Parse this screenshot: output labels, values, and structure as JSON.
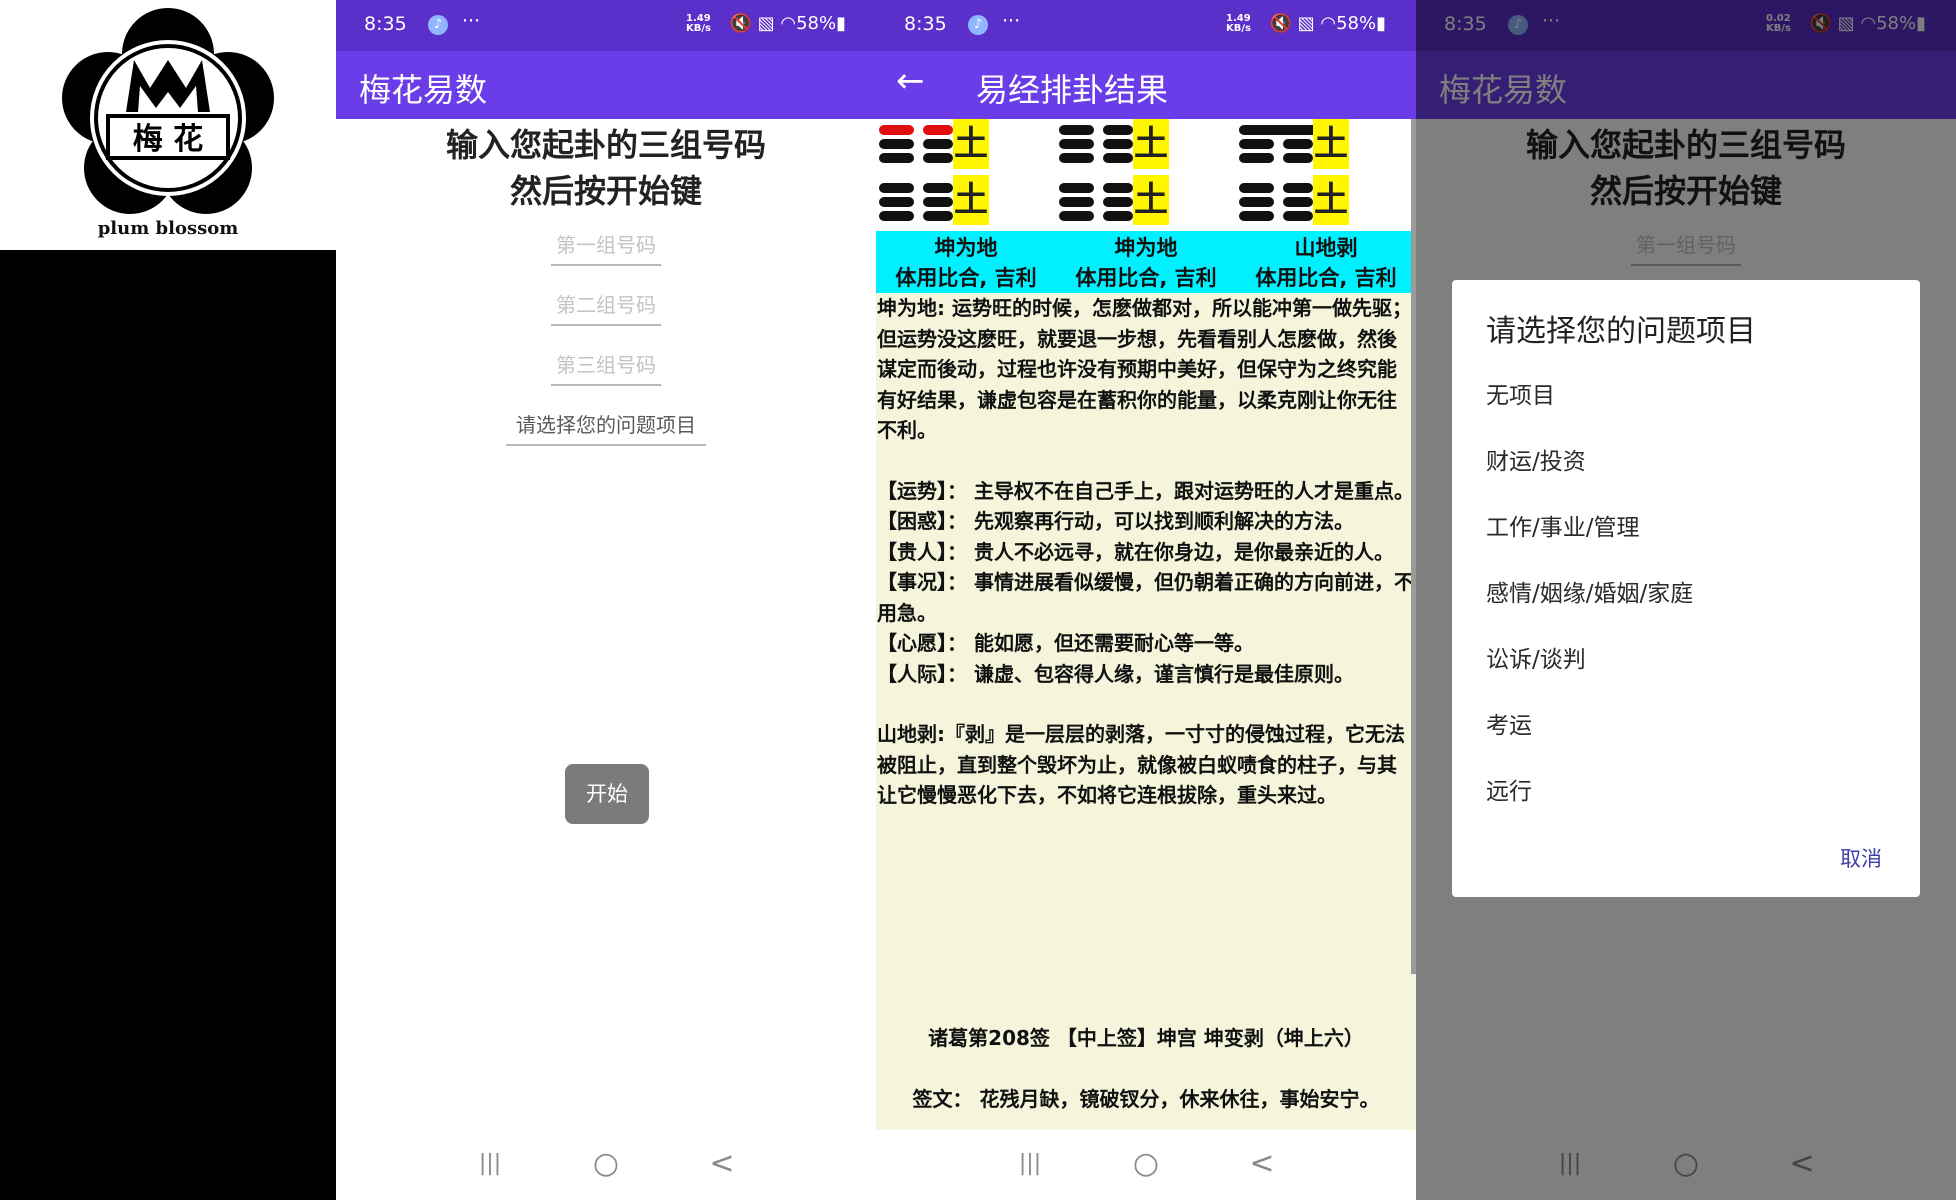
{
  "logo": {
    "emblem_text": "梅 花",
    "caption": "plum blossom"
  },
  "status": {
    "time": "8:35",
    "dots": "···",
    "speed_a": "1.49",
    "speed_b": "0.02",
    "speed_unit": "KB/s",
    "battery": "58%"
  },
  "screen1": {
    "app_title": "梅花易数",
    "headline_1": "输入您起卦的三组号码",
    "headline_2": "然后按开始键",
    "field1_placeholder": "第一组号码",
    "field2_placeholder": "第二组号码",
    "field3_placeholder": "第三组号码",
    "question_select": "请选择您的问题项目",
    "start_button": "开始"
  },
  "screen2": {
    "back_icon": "←",
    "title": "易经排卦结果",
    "earth": "土",
    "hexagrams": [
      {
        "name": "坤为地",
        "relation": "体用比合, 吉利"
      },
      {
        "name": "坤为地",
        "relation": "体用比合, 吉利"
      },
      {
        "name": "山地剥",
        "relation": "体用比合, 吉利"
      }
    ],
    "paragraph_main": "坤为地: 运势旺的时候，怎麽做都对，所以能冲第一做先驱；但运势没这麽旺，就要退一步想，先看看别人怎麽做，然後谋定而後动，过程也许没有预期中美好，但保守为之终究能有好结果，谦虚包容是在蓄积你的能量，以柔克刚让你无往不利。",
    "items": [
      {
        "k": "【运势】：",
        "v": "主导权不在自己手上，跟对运势旺的人才是重点。"
      },
      {
        "k": "【困惑】：",
        "v": "先观察再行动，可以找到顺利解决的方法。"
      },
      {
        "k": "【贵人】：",
        "v": "贵人不必远寻，就在你身边，是你最亲近的人。"
      },
      {
        "k": "【事况】：",
        "v": "事情进展看似缓慢，但仍朝着正确的方向前进，不用急。"
      },
      {
        "k": "【心愿】：",
        "v": "能如愿，但还需要耐心等一等。"
      },
      {
        "k": "【人际】：",
        "v": "谦虚、包容得人缘，谨言慎行是最佳原则。"
      }
    ],
    "paragraph_change": "山地剥:『剥』是一层层的剥落，一寸寸的侵蚀过程，它无法被阻止，直到整个毁坏为止，就像被白蚁啧食的柱子，与其让它慢慢恶化下去，不如将它连根拔除，重头来过。",
    "sign_header": "诸葛第208签 【中上签】坤宫 坤变剥（坤上六）",
    "sign_text": "签文： 花残月缺，镜破钗分，休来休往，事始安宁。"
  },
  "screen3": {
    "dialog_title": "请选择您的问题项目",
    "options": [
      "无项目",
      "财运/投资",
      "工作/事业/管理",
      "感情/姻缘/婚姻/家庭",
      "讼诉/谈判",
      "考运",
      "远行"
    ],
    "cancel": "取消"
  },
  "nav": {
    "recents": "|||",
    "home": "○",
    "back": "<"
  },
  "icons": [
    "music-note-icon",
    "mute-icon",
    "no-sim-icon",
    "wifi-icon",
    "battery-icon",
    "back-arrow-icon",
    "recents-icon",
    "home-icon",
    "back-nav-icon"
  ],
  "colors": {
    "status_bar": "#5b2fc9",
    "app_bar": "#6a3de8",
    "highlight_yellow": "#fff600",
    "highlight_cyan": "#00f0ff",
    "result_bg": "#f5f5dc",
    "button_gray": "#7b7b7b"
  }
}
